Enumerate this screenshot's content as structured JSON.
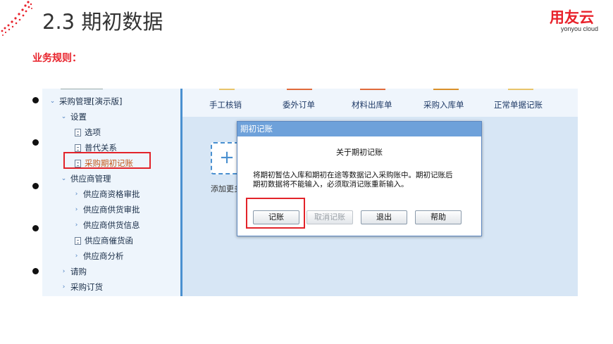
{
  "slide": {
    "title": "2.3 期初数据",
    "rule_label": "业务规则：",
    "logo_cn": "用友云",
    "logo_en": "yonyou cloud"
  },
  "colors": {
    "brand": "#e8222b",
    "nav_accent": "#4a90d0",
    "dialog_title": "#6ea1da"
  },
  "nav": {
    "items": [
      {
        "label": "采购管理[演示版]",
        "caret": "⌄",
        "icon": "chevron-down-icon"
      },
      {
        "label": "设置",
        "caret": "⌄",
        "icon": "chevron-down-icon"
      },
      {
        "label": "选项",
        "icon": "document-icon"
      },
      {
        "label": "普代关系",
        "icon": "document-icon"
      },
      {
        "label": "采购期初记账",
        "icon": "document-icon"
      },
      {
        "label": "供应商管理",
        "caret": "⌄",
        "icon": "chevron-down-icon"
      },
      {
        "label": "供应商资格审批",
        "caret": "›",
        "icon": "chevron-right-icon"
      },
      {
        "label": "供应商供货审批",
        "caret": "›",
        "icon": "chevron-right-icon"
      },
      {
        "label": "供应商供货信息",
        "caret": "›",
        "icon": "chevron-right-icon"
      },
      {
        "label": "供应商催货函",
        "icon": "document-icon"
      },
      {
        "label": "供应商分析",
        "caret": "›",
        "icon": "chevron-right-icon"
      },
      {
        "label": "请购",
        "caret": "›",
        "icon": "chevron-right-icon"
      },
      {
        "label": "采购订货",
        "caret": "›",
        "icon": "chevron-right-icon"
      }
    ]
  },
  "toolbar": {
    "items": [
      "手工核销",
      "委外订单",
      "材料出库单",
      "采购入库单",
      "正常单据记账"
    ]
  },
  "workspace": {
    "add_label": "添加更多",
    "add_icon": "plus-icon"
  },
  "dialog": {
    "title": "期初记账",
    "heading": "关于期初记账",
    "message_line1": "将期初暂估入库和期初在途等数据记入采购账中。期初记账后",
    "message_line2": "期初数据将不能输入，必须取消记账重新输入。",
    "buttons": {
      "post": "记账",
      "cancel_post": "取消记账",
      "exit": "退出",
      "help": "帮助"
    }
  }
}
